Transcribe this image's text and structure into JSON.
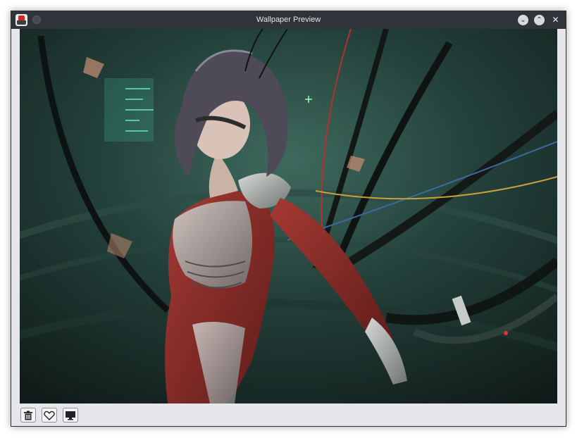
{
  "window": {
    "title": "Wallpaper Preview",
    "app_icon": "wallpaper-app-icon",
    "controls": {
      "minimize_glyph": "⌄",
      "maximize_glyph": "⌃",
      "close_glyph": "✕"
    }
  },
  "toolbar": {
    "buttons": [
      {
        "name": "delete-button",
        "icon": "trash-icon"
      },
      {
        "name": "favorite-button",
        "icon": "heart-icon"
      },
      {
        "name": "set-wallpaper-button",
        "icon": "monitor-icon"
      }
    ]
  },
  "preview": {
    "description_icon": "wallpaper-image",
    "colors": {
      "background": "#1d2a27",
      "accent_teal": "#3b5f55",
      "muscle_red": "#8a2a28"
    }
  }
}
